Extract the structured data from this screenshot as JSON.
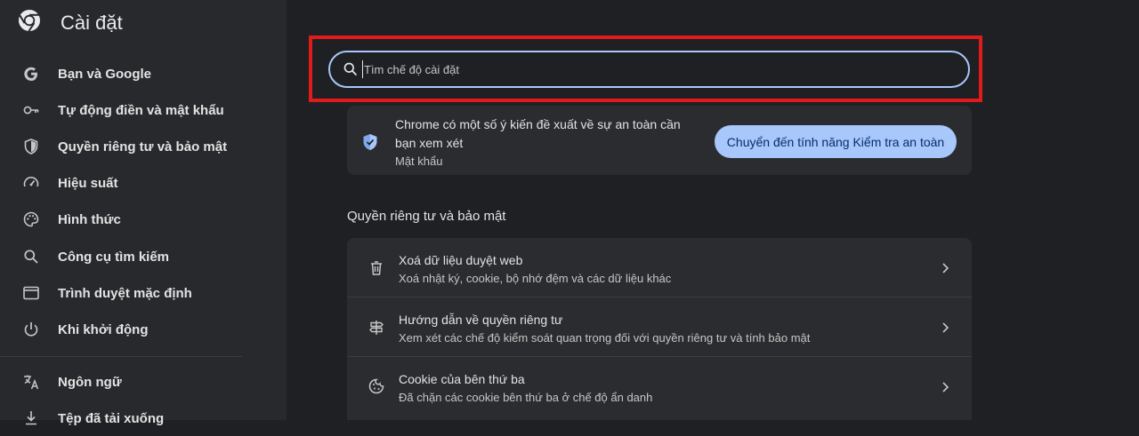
{
  "app": {
    "title": "Cài đặt",
    "logo_icon": "chrome-logo-icon"
  },
  "sidebar": {
    "items": [
      {
        "label": "Bạn và Google",
        "icon": "google-g-icon"
      },
      {
        "label": "Tự động điền và mật khẩu",
        "icon": "key-icon"
      },
      {
        "label": "Quyền riêng tư và bảo mật",
        "icon": "shield-icon"
      },
      {
        "label": "Hiệu suất",
        "icon": "speedometer-icon"
      },
      {
        "label": "Hình thức",
        "icon": "palette-icon"
      },
      {
        "label": "Công cụ tìm kiếm",
        "icon": "search-icon"
      },
      {
        "label": "Trình duyệt mặc định",
        "icon": "browser-window-icon"
      },
      {
        "label": "Khi khởi động",
        "icon": "power-icon"
      },
      {
        "label": "Ngôn ngữ",
        "icon": "translate-icon"
      },
      {
        "label": "Tệp đã tải xuống",
        "icon": "download-icon"
      }
    ]
  },
  "search": {
    "placeholder": "Tìm chế độ cài đặt",
    "highlight_color": "#e11b1b",
    "border_color": "#a8c7fa"
  },
  "safety_card": {
    "line1": "Chrome có một số ý kiến đề xuất về sự an toàn cần",
    "line2": "bạn xem xét",
    "subtitle": "Mật khẩu",
    "button_label": "Chuyển đến tính năng Kiểm tra an toàn",
    "icon": "shield-check-icon"
  },
  "privacy": {
    "section_title": "Quyền riêng tư và bảo mật",
    "rows": [
      {
        "title": "Xoá dữ liệu duyệt web",
        "subtitle": "Xoá nhật ký, cookie, bộ nhớ đệm và các dữ liệu khác",
        "icon": "trash-icon"
      },
      {
        "title": "Hướng dẫn về quyền riêng tư",
        "subtitle": "Xem xét các chế độ kiểm soát quan trọng đối với quyền riêng tư và tính bảo mật",
        "icon": "signpost-icon"
      },
      {
        "title": "Cookie của bên thứ ba",
        "subtitle": "Đã chặn các cookie bên thứ ba ở chế độ ẩn danh",
        "icon": "cookie-icon"
      }
    ]
  },
  "colors": {
    "accent": "#a8c7fa",
    "background": "#1f2023",
    "sidebar": "#28292c"
  }
}
